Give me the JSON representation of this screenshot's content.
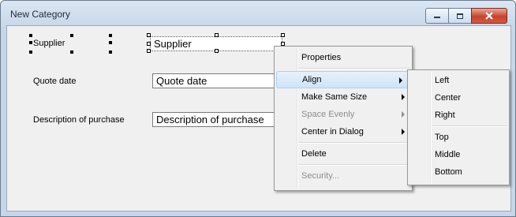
{
  "window": {
    "title": "New Category"
  },
  "fields": [
    {
      "label": "Supplier",
      "value": "Supplier"
    },
    {
      "label": "Quote date",
      "value": "Quote date"
    },
    {
      "label": "Description of purchase",
      "value": "Description of purchase"
    }
  ],
  "context_menu": {
    "items": [
      "Properties",
      "Align",
      "Make Same Size",
      "Space Evenly",
      "Center in Dialog",
      "Delete",
      "Security..."
    ],
    "highlighted": "Align",
    "disabled": [
      "Space Evenly",
      "Security..."
    ]
  },
  "align_submenu": {
    "items": [
      "Left",
      "Center",
      "Right",
      "Top",
      "Middle",
      "Bottom"
    ]
  }
}
